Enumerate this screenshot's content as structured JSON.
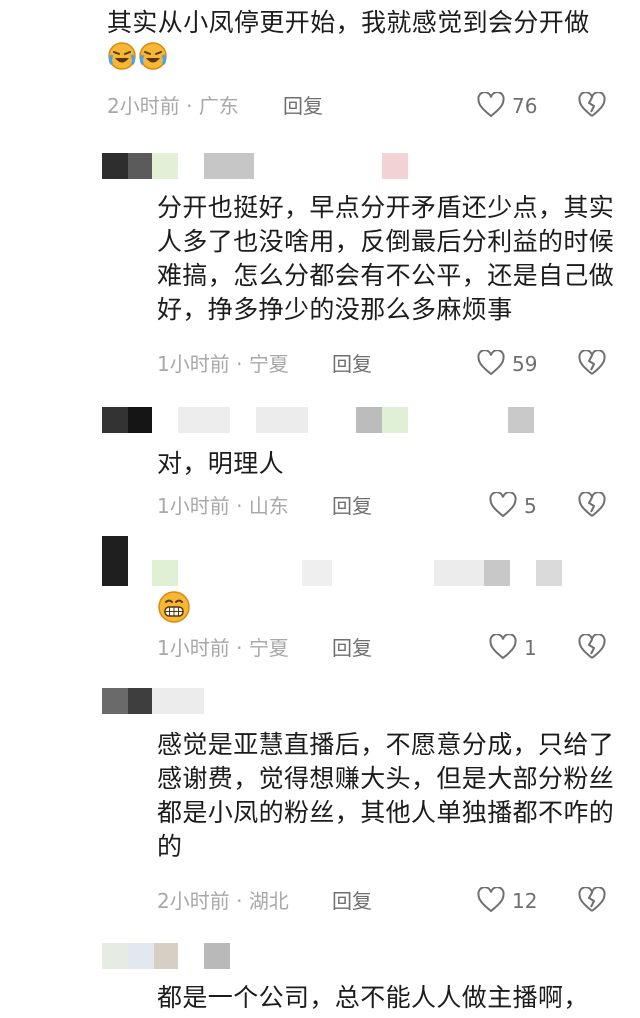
{
  "comments": [
    {
      "text": "其实从小凤停更开始，我就感觉到会分开做",
      "time": "2小时前",
      "location": "广东",
      "reply_label": "回复",
      "likes": "76"
    },
    {
      "text": "分开也挺好，早点分开矛盾还少点，其实人多了也没啥用，反倒最后分利益的时候难搞，怎么分都会有不公平，还是自己做好，挣多挣少的没那么多麻烦事",
      "time": "1小时前",
      "location": "宁夏",
      "reply_label": "回复",
      "likes": "59"
    },
    {
      "text": "对，明理人",
      "time": "1小时前",
      "location": "山东",
      "reply_label": "回复",
      "likes": "5"
    },
    {
      "text": "",
      "time": "1小时前",
      "location": "宁夏",
      "reply_label": "回复",
      "likes": "1"
    },
    {
      "text": "感觉是亚慧直播后，不愿意分成，只给了感谢费，觉得想赚大头，但是大部分粉丝都是小凤的粉丝，其他人单独播都不咋的的",
      "time": "2小时前",
      "location": "湖北",
      "reply_label": "回复",
      "likes": "12"
    },
    {
      "text": "都是一个公司，总不能人人做主播啊，",
      "time": "",
      "location": "",
      "reply_label": "",
      "likes": ""
    }
  ],
  "meta_separator": "·",
  "icons": {
    "like": "heart-outline-icon",
    "dislike": "broken-heart-icon",
    "emoji_laugh_cry": "laugh-cry-emoji-icon",
    "emoji_grin": "grin-emoji-icon"
  },
  "colors": {
    "text": "#1c1c1c",
    "meta": "#a8a8a8",
    "action": "#6f6f6f"
  }
}
